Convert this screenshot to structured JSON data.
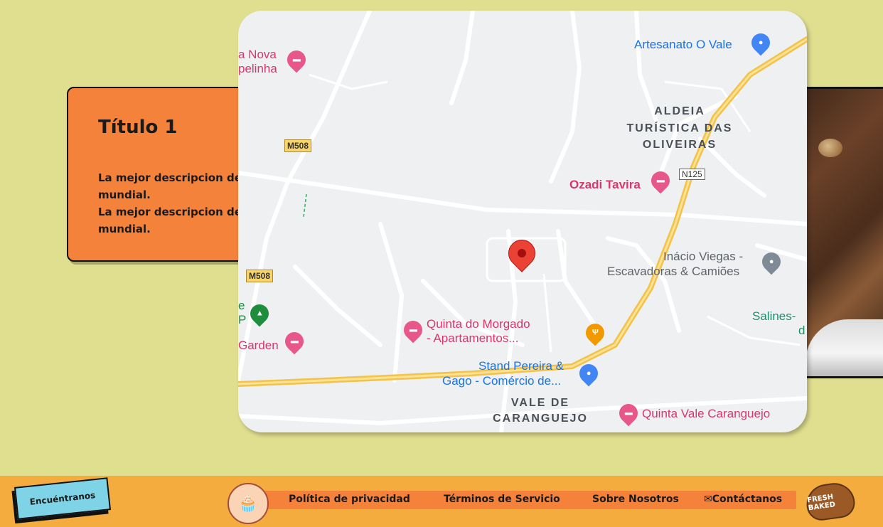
{
  "card": {
    "title": "Título 1",
    "line1": "La mejor descripcion de",
    "line2": "mundial.",
    "line3": "La mejor descripcion de",
    "line4": "mundial."
  },
  "map": {
    "labels": {
      "artesanato": "Artesanato O Vale",
      "nova": "a Nova",
      "capelinha": "pelinha",
      "aldeia": "ALDEIA",
      "turistica": "TURÍSTICA DAS",
      "oliveiras": "OLIVEIRAS",
      "ozadi": "Ozadi Tavira",
      "inacio1": "Inácio Viegas -",
      "inacio2": "Escavadoras & Camiões",
      "salines": "Salines-",
      "salines2": "d",
      "quinta_morgado1": "Quinta do Morgado",
      "quinta_morgado2": "- Apartamentos...",
      "garden": "Garden",
      "e_letter": "e",
      "p_letter": "P",
      "stand1": "Stand Pereira &",
      "stand2": "Gago - Comércio de...",
      "vale1": "VALE DE",
      "vale2": "CARANGUEJO",
      "quinta_vale": "Quinta Vale Caranguejo"
    },
    "roads": {
      "m508_top": "M508",
      "m508_bottom": "M508",
      "n125": "N125"
    }
  },
  "footer": {
    "find_label": "Encuéntranos",
    "privacy": "Política de privacidad",
    "terms": "Términos de Servicio",
    "about": "Sobre Nosotros",
    "contact": "Contáctanos",
    "logo_right_text": "FRESH BAKED"
  }
}
